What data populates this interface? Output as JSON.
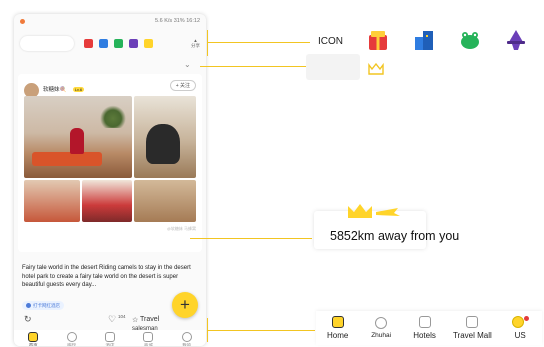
{
  "status_bar": {
    "network": "5.6 K/s",
    "battery": "31%",
    "time": "16:12"
  },
  "topbar": {
    "share_label": "分享"
  },
  "post": {
    "author_name": "软糖妹🍭",
    "author_level": "Lv.6",
    "author_meta": "24天前发布",
    "follow_label": "+ 关注",
    "watermark": "@软糖妹 马蜂窝",
    "caption": "Fairy tale world in the desert Riding camels to stay in the desert hotel park to create a fairy tale world on the desert is super beautiful guests every day...",
    "tag": "打卡网红酒店",
    "like_count": "104",
    "travel_label": "Travel",
    "salesman_label": "salesman",
    "fab_label": "+"
  },
  "bottom_tabs_cn": [
    "首页",
    "嗨玩",
    "酒店",
    "商城",
    "我的"
  ],
  "callouts": {
    "icon_title": "ICON",
    "distance_text": "5852km away from you",
    "bottom_tabs_en": [
      "Home",
      "Zhuhai",
      "Hotels",
      "Travel Mall",
      "US"
    ]
  },
  "colors": {
    "accent": "#ffd42a",
    "guide_line": "#f2c522",
    "icon_red": "#e63b3b",
    "icon_blue": "#2f7de1",
    "icon_green": "#26b35a",
    "icon_purple": "#6b3fb8"
  },
  "icons": [
    "gift-icon",
    "city-icon",
    "frog-icon",
    "witch-icon",
    "plane-icon"
  ]
}
